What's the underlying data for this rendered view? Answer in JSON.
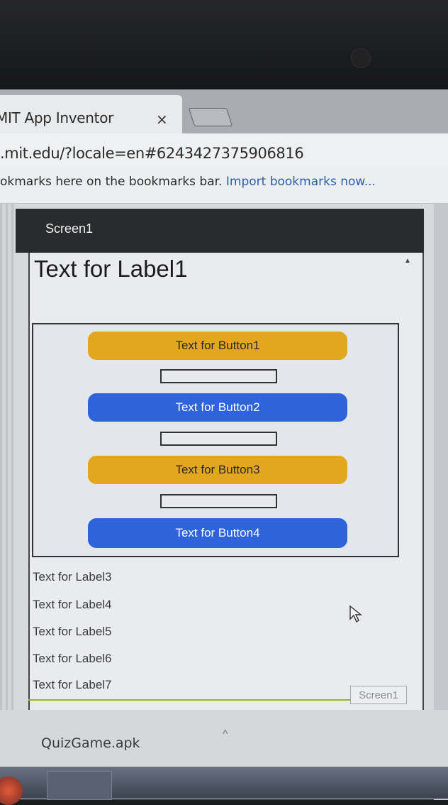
{
  "browser": {
    "tab_title": "MIT App Inventor",
    "tab_close": "×",
    "url": ".mit.edu/?locale=en#6243427375906816",
    "bookmarks_text": "okmarks here on the bookmarks bar.",
    "bookmarks_link": "Import bookmarks now..."
  },
  "app": {
    "screen_title": "Screen1",
    "label1": "Text for Label1",
    "buttons": [
      {
        "label": "Text for Button1",
        "color": "#e2a61f"
      },
      {
        "label": "Text for Button2",
        "color": "#2e63dc"
      },
      {
        "label": "Text for Button3",
        "color": "#e2a61f"
      },
      {
        "label": "Text for Button4",
        "color": "#2e63dc"
      }
    ],
    "labels": [
      "Text for Label3",
      "Text for Label4",
      "Text for Label5",
      "Text for Label6",
      "Text for Label7"
    ],
    "screen_selector": "Screen1"
  },
  "downloads": {
    "file": "QuizGame.apk",
    "chevron": "^"
  }
}
